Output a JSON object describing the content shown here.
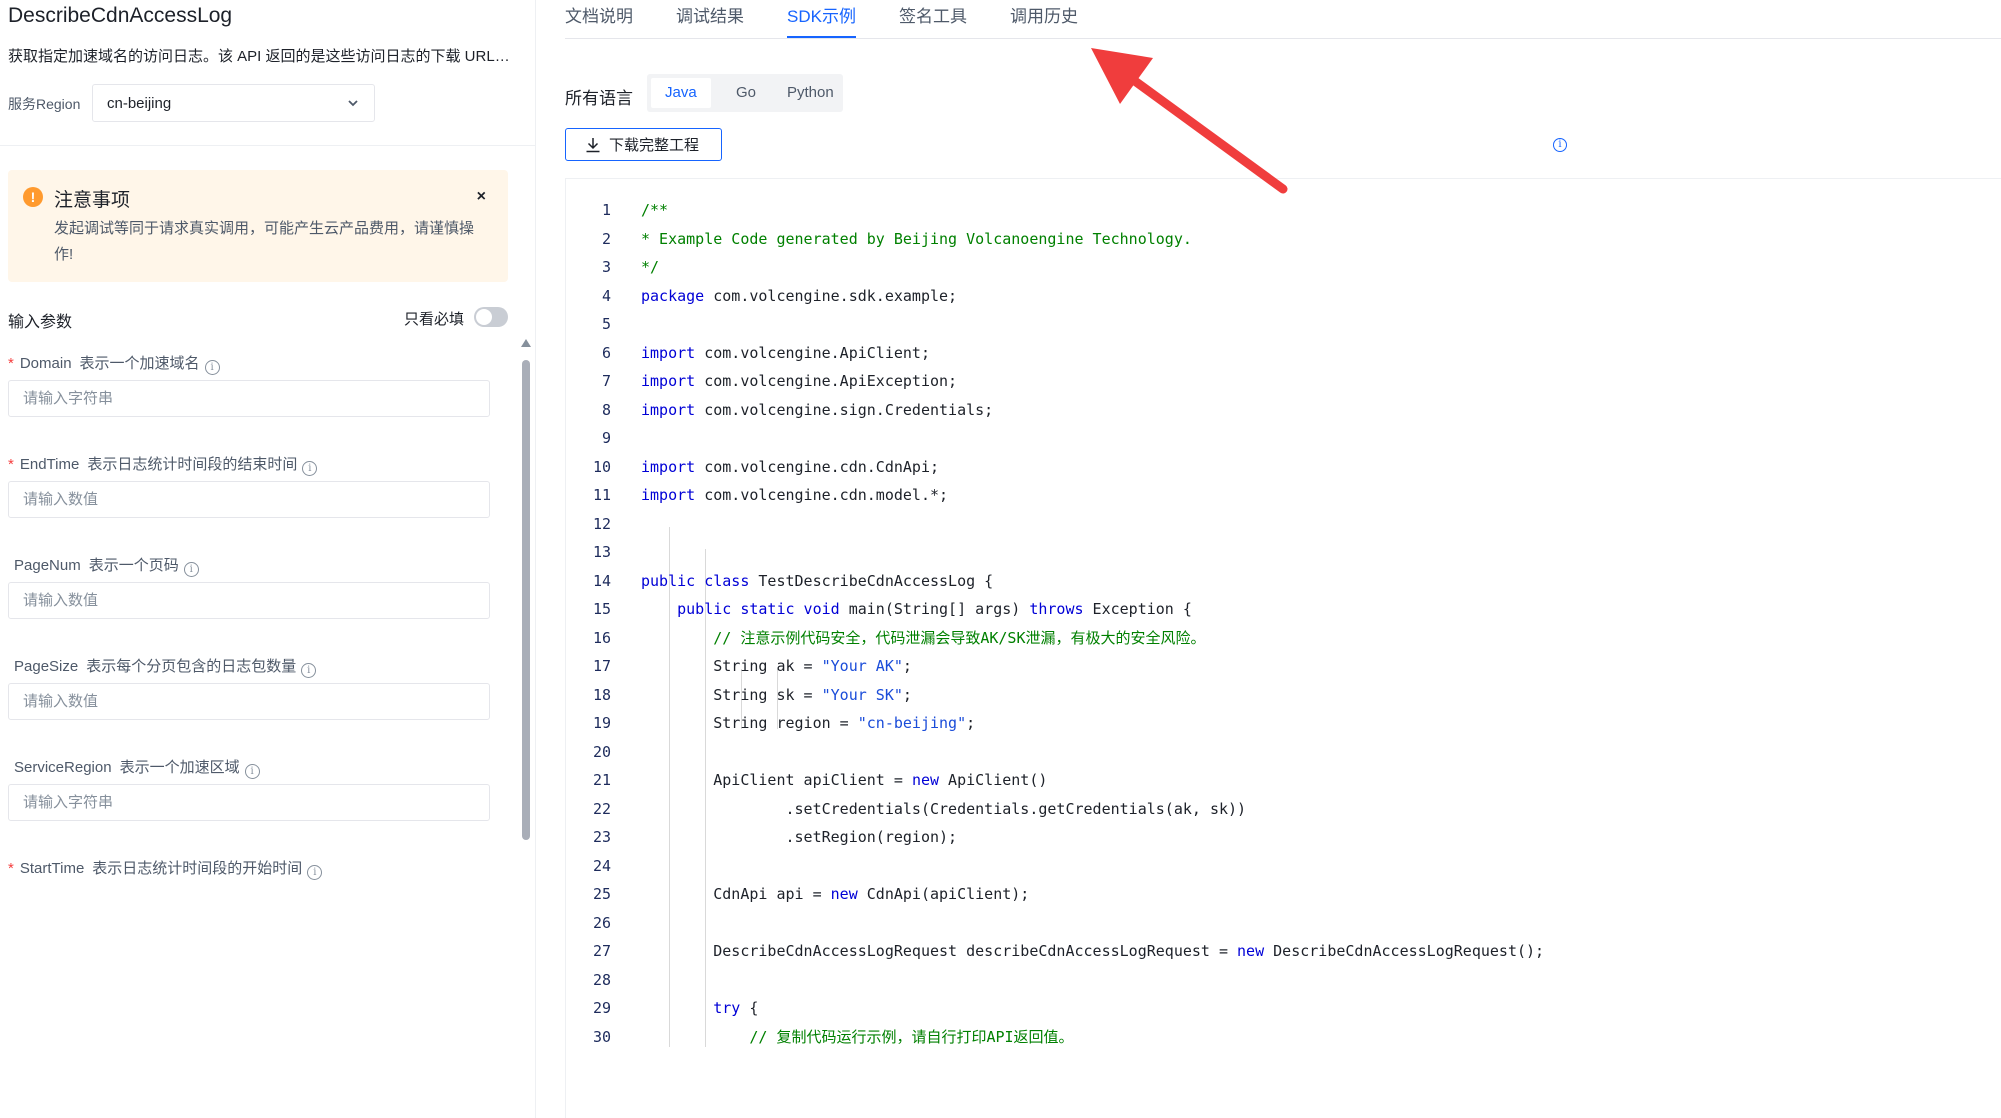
{
  "left": {
    "api_title": "DescribeCdnAccessLog",
    "api_desc": "获取指定加速域名的访问日志。该 API 返回的是这些访问日志的下载 URL。火...",
    "region_label": "服务Region",
    "region_value": "cn-beijing",
    "notice": {
      "title": "注意事项",
      "close": "×",
      "body": "发起调试等同于请求真实调用，可能产生云产品费用，请谨慎操作!"
    },
    "params_title": "输入参数",
    "required_only": "只看必填",
    "fields": [
      {
        "required": "*",
        "name": "Domain",
        "desc": "表示一个加速域名",
        "placeholder": "请输入字符串"
      },
      {
        "required": "*",
        "name": "EndTime",
        "desc": "表示日志统计时间段的结束时间",
        "placeholder": "请输入数值"
      },
      {
        "required": "",
        "name": "PageNum",
        "desc": "表示一个页码",
        "placeholder": "请输入数值"
      },
      {
        "required": "",
        "name": "PageSize",
        "desc": "表示每个分页包含的日志包数量",
        "placeholder": "请输入数值"
      },
      {
        "required": "",
        "name": "ServiceRegion",
        "desc": "表示一个加速区域",
        "placeholder": "请输入字符串"
      },
      {
        "required": "*",
        "name": "StartTime",
        "desc": "表示日志统计时间段的开始时间",
        "placeholder": ""
      }
    ]
  },
  "right": {
    "tabs": [
      "文档说明",
      "调试结果",
      "SDK示例",
      "签名工具",
      "调用历史"
    ],
    "active_tab": "SDK示例",
    "lang_label": "所有语言",
    "languages": [
      "Java",
      "Go",
      "Python"
    ],
    "active_language": "Java",
    "download_label": "下载完整工程",
    "code_lines": [
      [
        [
          "c",
          "/**"
        ]
      ],
      [
        [
          "c",
          "* Example Code generated by Beijing Volcanoengine Technology."
        ]
      ],
      [
        [
          "c",
          "*/"
        ]
      ],
      [
        [
          "k",
          "package"
        ],
        [
          "p",
          " com.volcengine.sdk.example;"
        ]
      ],
      [],
      [
        [
          "k",
          "import"
        ],
        [
          "p",
          " com.volcengine.ApiClient;"
        ]
      ],
      [
        [
          "k",
          "import"
        ],
        [
          "p",
          " com.volcengine.ApiException;"
        ]
      ],
      [
        [
          "k",
          "import"
        ],
        [
          "p",
          " com.volcengine.sign.Credentials;"
        ]
      ],
      [],
      [
        [
          "k",
          "import"
        ],
        [
          "p",
          " com.volcengine.cdn.CdnApi;"
        ]
      ],
      [
        [
          "k",
          "import"
        ],
        [
          "p",
          " com.volcengine.cdn.model.*;"
        ]
      ],
      [],
      [],
      [
        [
          "k",
          "public class"
        ],
        [
          "p",
          " TestDescribeCdnAccessLog {"
        ]
      ],
      [
        [
          "p",
          "    "
        ],
        [
          "k",
          "public static void"
        ],
        [
          "p",
          " main(String[] args) "
        ],
        [
          "k",
          "throws"
        ],
        [
          "p",
          " Exception {"
        ]
      ],
      [
        [
          "p",
          "        "
        ],
        [
          "c",
          "// 注意示例代码安全，代码泄漏会导致AK/SK泄漏，有极大的安全风险。"
        ]
      ],
      [
        [
          "p",
          "        String ak = "
        ],
        [
          "s",
          "\"Your AK\""
        ],
        [
          "p",
          ";"
        ]
      ],
      [
        [
          "p",
          "        String sk = "
        ],
        [
          "s",
          "\"Your SK\""
        ],
        [
          "p",
          ";"
        ]
      ],
      [
        [
          "p",
          "        String region = "
        ],
        [
          "s",
          "\"cn-beijing\""
        ],
        [
          "p",
          ";"
        ]
      ],
      [],
      [
        [
          "p",
          "        ApiClient apiClient = "
        ],
        [
          "k",
          "new"
        ],
        [
          "p",
          " ApiClient()"
        ]
      ],
      [
        [
          "p",
          "                .setCredentials(Credentials.getCredentials(ak, sk))"
        ]
      ],
      [
        [
          "p",
          "                .setRegion(region);"
        ]
      ],
      [],
      [
        [
          "p",
          "        CdnApi api = "
        ],
        [
          "k",
          "new"
        ],
        [
          "p",
          " CdnApi(apiClient);"
        ]
      ],
      [],
      [
        [
          "p",
          "        DescribeCdnAccessLogRequest describeCdnAccessLogRequest = "
        ],
        [
          "k",
          "new"
        ],
        [
          "p",
          " DescribeCdnAccessLogRequest();"
        ]
      ],
      [],
      [
        [
          "p",
          "        "
        ],
        [
          "k",
          "try"
        ],
        [
          "p",
          " {"
        ]
      ],
      [
        [
          "p",
          "            "
        ],
        [
          "c",
          "// 复制代码运行示例，请自行打印API返回值。"
        ]
      ]
    ]
  },
  "colors": {
    "accent": "#1664ff",
    "required_star": "#f53f3f",
    "notice_bg": "#fff6e9",
    "warning": "#ff9a2e",
    "arrow": "#f03d3d",
    "keyword": "#0000d6",
    "string": "#1a4cd9",
    "comment": "#008000"
  },
  "icons": {
    "region_chevron": "chevron-down-icon",
    "notice": "warning-icon",
    "download": "download-icon",
    "info": "info-icon"
  }
}
